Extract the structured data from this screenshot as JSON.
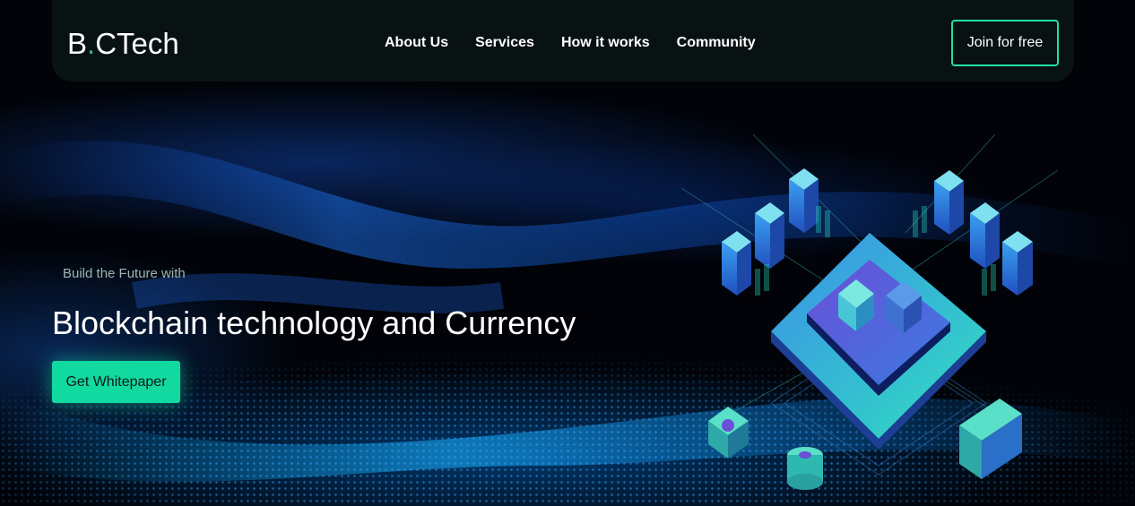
{
  "logo": {
    "part1": "B",
    "dot": ".",
    "part2": "CTech"
  },
  "nav": {
    "links": [
      {
        "label": "About Us"
      },
      {
        "label": "Services"
      },
      {
        "label": "How it works"
      },
      {
        "label": "Community"
      }
    ],
    "join_label": "Join for free"
  },
  "hero": {
    "subtitle": "Build the Future with",
    "title": "Blockchain technology and Currency",
    "cta_label": "Get Whitepaper"
  },
  "colors": {
    "accent": "#12d9a0",
    "join_border": "#22e0a0",
    "background": "#000000"
  },
  "icons": [
    "blockchain-isometric-illustration",
    "dotted-wave-background"
  ]
}
